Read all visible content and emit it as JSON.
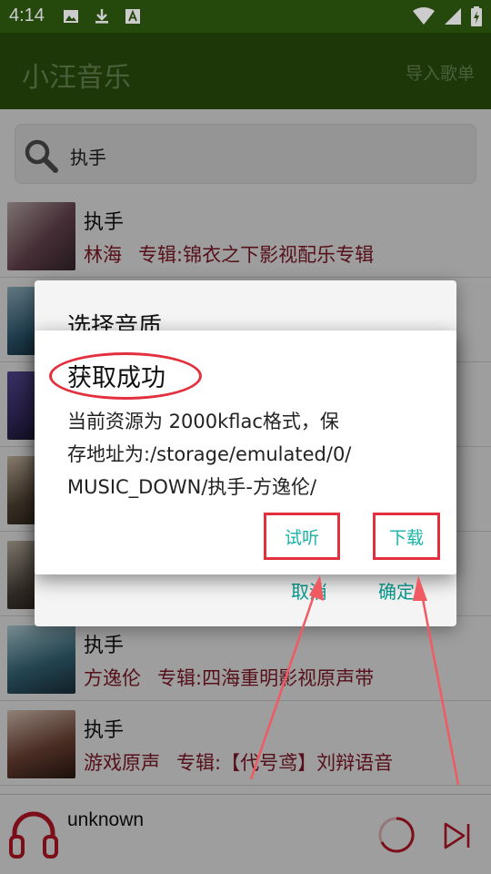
{
  "status_bar": {
    "time": "4:14",
    "left_icons": [
      "image-icon",
      "download-icon",
      "font-icon"
    ],
    "right_icons": [
      "wifi-icon",
      "signal-icon",
      "battery-charging-icon"
    ]
  },
  "app_bar": {
    "title": "小汪音乐",
    "import_label": "导入歌单"
  },
  "search": {
    "value": "执手"
  },
  "songs": [
    {
      "title": "执手",
      "artist": "林海",
      "album": "专辑:锦衣之下影视配乐专辑",
      "thumb_color": "#6f4a56"
    },
    {
      "title": "",
      "artist": "",
      "album": "",
      "thumb_color": "#2f5d78"
    },
    {
      "title": "",
      "artist": "",
      "album": "",
      "thumb_color": "#3b2f6a"
    },
    {
      "title": "",
      "artist": "",
      "album": "",
      "thumb_color": "#5b4a3a"
    },
    {
      "title": "",
      "artist": "",
      "album": "",
      "thumb_color": "#4a4238"
    },
    {
      "title": "执手",
      "artist": "方逸伦",
      "album": "专辑:四海重明影视原声带",
      "thumb_color": "#3a6f82"
    },
    {
      "title": "执手",
      "artist": "游戏原声",
      "album": "专辑:【代号鸢】刘辩语音",
      "thumb_color": "#7a4a3c"
    }
  ],
  "player": {
    "track_name": "unknown",
    "accent": "#c8182a"
  },
  "bg_dialog": {
    "title": "选择音质",
    "cancel_label": "取消",
    "confirm_label": "确定"
  },
  "dialog": {
    "title": "获取成功",
    "message_lines": [
      "当前资源为 2000kflac格式，保",
      "存地址为:/storage/emulated/0/",
      "MUSIC_DOWN/执手-方逸伦/"
    ],
    "preview_label": "试听",
    "download_label": "下载"
  },
  "colors": {
    "app_bar": "#2f5a10",
    "artist_text": "#8b1a2a",
    "dialog_button": "#17b3a8",
    "annotation": "#e2303e"
  }
}
